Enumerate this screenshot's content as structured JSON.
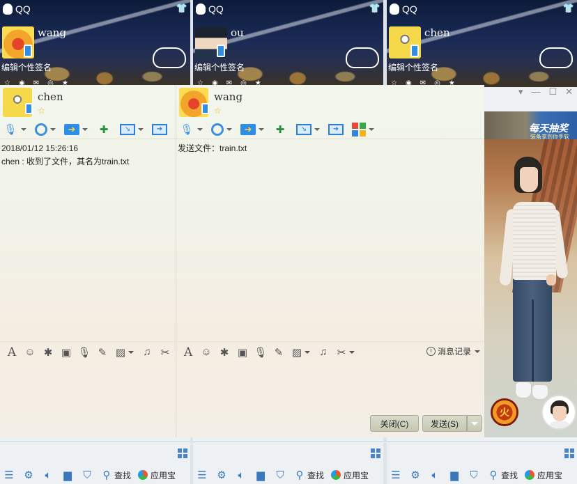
{
  "qq_panels": [
    {
      "app": "QQ",
      "user": "wang",
      "signature": "编辑个性签名",
      "bottom": {
        "find": "查找",
        "app_store": "应用宝"
      }
    },
    {
      "app": "QQ",
      "user": "ou",
      "signature": "编辑个性签名",
      "bottom": {
        "find": "查找",
        "app_store": "应用宝"
      }
    },
    {
      "app": "QQ",
      "user": "chen",
      "signature": "编辑个性签名",
      "bottom": {
        "find": "查找",
        "app_store": "应用宝"
      }
    }
  ],
  "chat_left": {
    "name": "chen",
    "timestamp": "2018/01/12 15:26:16",
    "message": "chen : 收到了文件，其名为train.txt"
  },
  "chat_right": {
    "name": "wang",
    "message": "发送文件：train.txt",
    "history_label": "消息记录",
    "close_label": "关闭(C)",
    "send_label": "发送(S)"
  },
  "ad": {
    "title": "每天抽奖",
    "subtitle": "装备拿到你手软"
  },
  "fire_badge": "火",
  "window_controls": {
    "collapse": "▾",
    "minimize": "—",
    "maximize": "☐",
    "close": "✕"
  },
  "colors": {
    "accent": "#2d6cb3",
    "button_bg": "#cfd1bd"
  }
}
